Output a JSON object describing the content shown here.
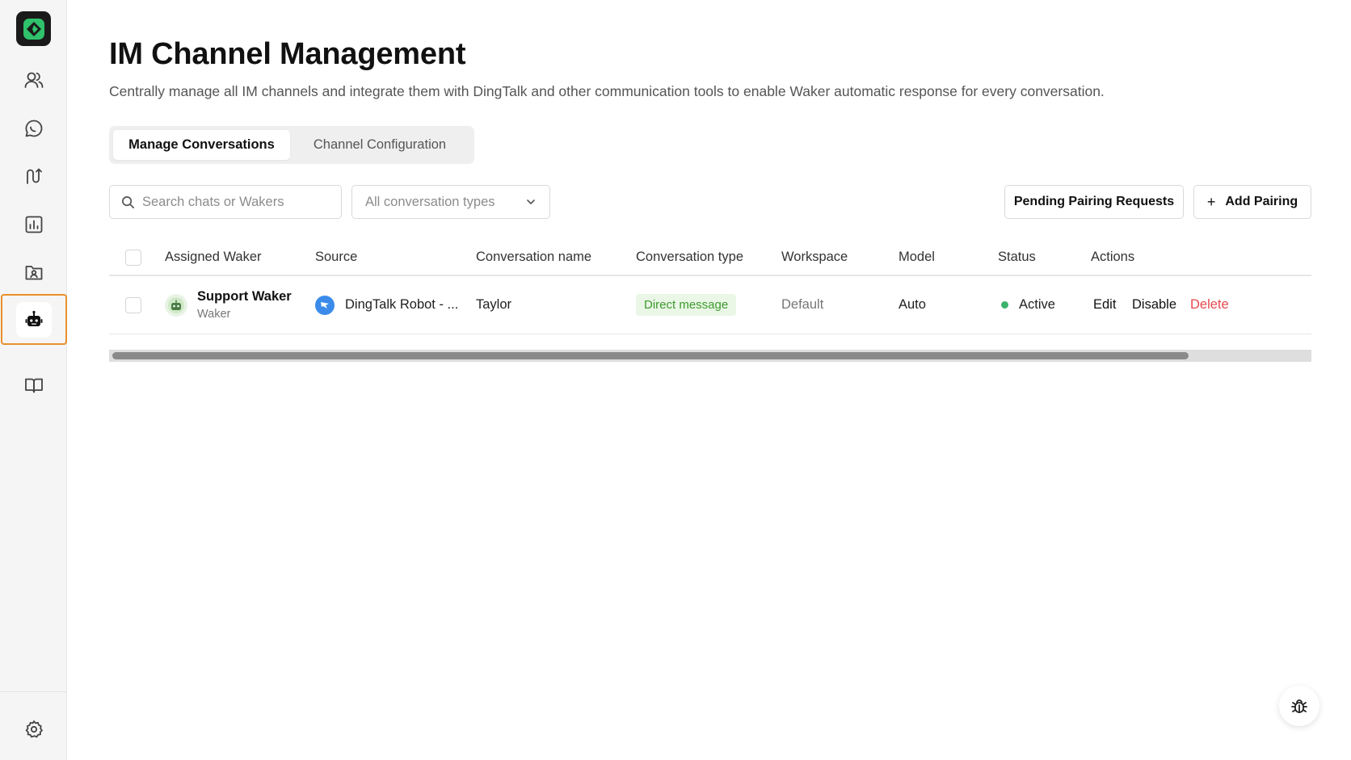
{
  "sidebar": {
    "logo": "app-logo",
    "items": [
      {
        "name": "users",
        "icon": "users-icon"
      },
      {
        "name": "chat",
        "icon": "chat-bubble-icon"
      },
      {
        "name": "workflow",
        "icon": "route-icon"
      },
      {
        "name": "analytics",
        "icon": "bar-chart-icon"
      },
      {
        "name": "contacts",
        "icon": "contact-folder-icon"
      },
      {
        "name": "im-channels",
        "icon": "robot-icon",
        "active": true
      },
      {
        "name": "knowledge",
        "icon": "book-icon"
      }
    ],
    "settings_icon": "gear-icon",
    "active_color": "#e8902b"
  },
  "page": {
    "title": "IM Channel Management",
    "description": "Centrally manage all IM channels and integrate them with DingTalk and other communication tools to enable Waker automatic response for every conversation."
  },
  "tabs": [
    {
      "label": "Manage Conversations",
      "active": true
    },
    {
      "label": "Channel Configuration",
      "active": false
    }
  ],
  "filters": {
    "search_placeholder": "Search chats or Wakers",
    "type_select_value": "All conversation types"
  },
  "buttons": {
    "pending": "Pending Pairing Requests",
    "add_plus": "+",
    "add": "Add Pairing"
  },
  "table": {
    "headers": {
      "assigned_waker": "Assigned Waker",
      "source": "Source",
      "conversation_name": "Conversation name",
      "conversation_type": "Conversation type",
      "workspace": "Workspace",
      "model": "Model",
      "status": "Status",
      "actions": "Actions"
    },
    "rows": [
      {
        "waker_name": "Support Waker",
        "waker_sub": "Waker",
        "source": "DingTalk Robot - ...",
        "conversation_name": "Taylor",
        "conversation_type": "Direct message",
        "workspace": "Default",
        "model": "Auto",
        "status": "Active",
        "actions": {
          "edit": "Edit",
          "disable": "Disable",
          "delete": "Delete"
        }
      }
    ]
  },
  "colors": {
    "status_active": "#3bb36b",
    "badge_bg": "#eaf7e6",
    "badge_text": "#3d9a2e",
    "delete": "#e5484d",
    "dingtalk": "#3b8bea"
  },
  "fab_icon": "bug-icon"
}
